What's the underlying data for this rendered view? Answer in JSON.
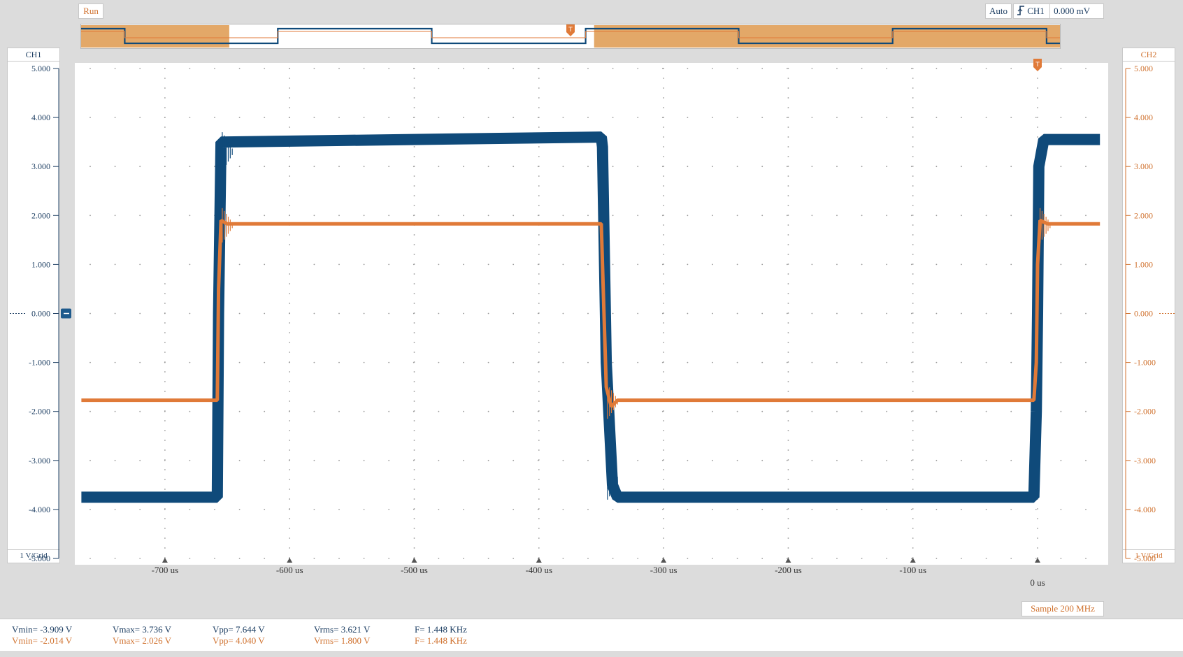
{
  "status": {
    "run_label": "Run"
  },
  "trigger": {
    "mode": "Auto",
    "source": "CH1",
    "level": "0.000 mV",
    "icon": "rising-edge-icon"
  },
  "colors": {
    "ch1": "#0f4a7a",
    "ch2": "#e07a38",
    "overview_fill": "#e3a868",
    "grid": "#9a9a9a"
  },
  "ch1": {
    "label": "CH1",
    "scale": "1 V/Grid",
    "ticks": [
      "5.000",
      "4.000",
      "3.000",
      "2.000",
      "1.000",
      "0.000",
      "-1.000",
      "-2.000",
      "-3.000",
      "-4.000",
      "-5.000"
    ]
  },
  "ch2": {
    "label": "CH2",
    "scale": "1 V/Grid",
    "ticks": [
      "5.000",
      "4.000",
      "3.000",
      "2.000",
      "1.000",
      "0.000",
      "-1.000",
      "-2.000",
      "-3.000",
      "-4.000",
      "-5.000"
    ]
  },
  "time_axis": {
    "labels": [
      "-700 us",
      "-600 us",
      "-500 us",
      "-400 us",
      "-300 us",
      "-200 us",
      "-100 us"
    ],
    "zero_label": "0 us"
  },
  "acquisition": {
    "sample_label": "Sample 200 MHz"
  },
  "measurements": {
    "ch1": {
      "vmin": "Vmin= -3.909 V",
      "vmax": "Vmax= 3.736 V",
      "vpp": "Vpp= 7.644 V",
      "vrms": "Vrms= 3.621 V",
      "freq": "F= 1.448 KHz"
    },
    "ch2": {
      "vmin": "Vmin= -2.014 V",
      "vmax": "Vmax= 2.026 V",
      "vpp": "Vpp= 4.040 V",
      "vrms": "Vrms= 1.800 V",
      "freq": "F= 1.448 KHz"
    }
  },
  "chart_data": {
    "type": "line",
    "xlabel": "",
    "ylabel": "",
    "xlim": [
      -767,
      53
    ],
    "ylim": [
      -5,
      5
    ],
    "grid": true,
    "series": [
      {
        "name": "CH1",
        "x": [
          -767,
          -658,
          -657,
          -655,
          -350,
          -349,
          -346,
          -341,
          -337,
          -3,
          -1,
          0,
          1,
          5,
          50
        ],
        "y": [
          -3.75,
          -3.75,
          0.0,
          3.5,
          3.6,
          3.4,
          -1.0,
          -3.5,
          -3.75,
          -3.75,
          -2.0,
          0.0,
          3.0,
          3.55,
          3.55
        ]
      },
      {
        "name": "CH2",
        "x": [
          -767,
          -658,
          -657,
          -655,
          -650,
          -350,
          -349,
          -346,
          -342,
          -337,
          -3,
          -1,
          0,
          2,
          8,
          50
        ],
        "y": [
          -1.77,
          -1.77,
          0.5,
          1.9,
          1.83,
          1.83,
          1.0,
          -1.5,
          -1.9,
          -1.77,
          -1.77,
          -1.0,
          1.0,
          1.9,
          1.83,
          1.83
        ]
      }
    ]
  }
}
